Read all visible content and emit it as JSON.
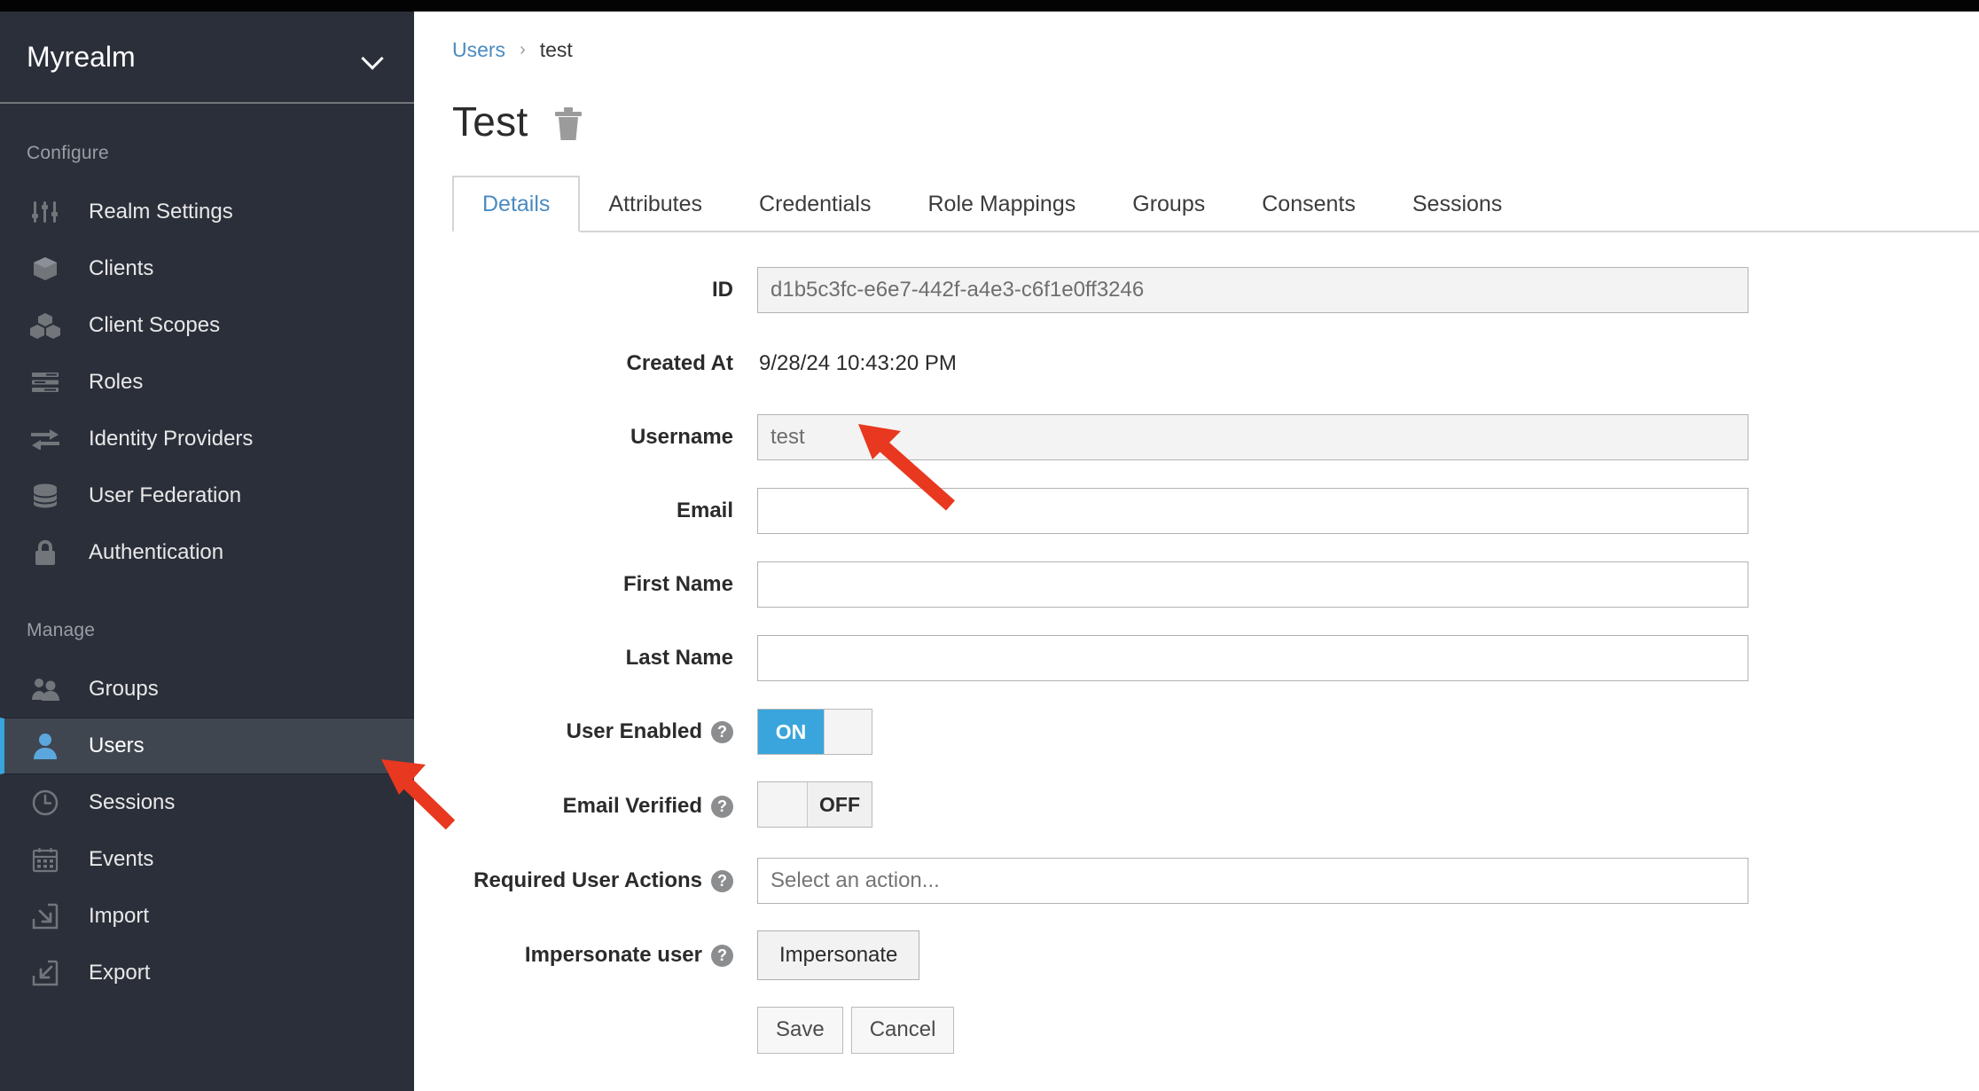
{
  "colors": {
    "sidebar_bg": "#2b2f3a",
    "sidebar_active_bg": "#3f4650",
    "accent_blue": "#39a5dc",
    "link_blue": "#4a8bc2",
    "annotation_red": "#e8381f"
  },
  "sidebar": {
    "realm": {
      "name": "Myrealm",
      "chevron_icon": "chevron-down-icon"
    },
    "sections": [
      {
        "label": "Configure",
        "items": [
          {
            "label": "Realm Settings",
            "icon": "sliders-icon",
            "active": false
          },
          {
            "label": "Clients",
            "icon": "cube-icon",
            "active": false
          },
          {
            "label": "Client Scopes",
            "icon": "cubes-icon",
            "active": false
          },
          {
            "label": "Roles",
            "icon": "list-bars-icon",
            "active": false
          },
          {
            "label": "Identity Providers",
            "icon": "exchange-arrows-icon",
            "active": false
          },
          {
            "label": "User Federation",
            "icon": "database-icon",
            "active": false
          },
          {
            "label": "Authentication",
            "icon": "lock-icon",
            "active": false
          }
        ]
      },
      {
        "label": "Manage",
        "items": [
          {
            "label": "Groups",
            "icon": "users-group-icon",
            "active": false
          },
          {
            "label": "Users",
            "icon": "user-icon",
            "active": true
          },
          {
            "label": "Sessions",
            "icon": "clock-icon",
            "active": false
          },
          {
            "label": "Events",
            "icon": "calendar-icon",
            "active": false
          },
          {
            "label": "Import",
            "icon": "import-arrow-icon",
            "active": false
          },
          {
            "label": "Export",
            "icon": "export-arrow-icon",
            "active": false
          }
        ]
      }
    ]
  },
  "breadcrumb": {
    "parent": "Users",
    "separator": "›",
    "current": "test"
  },
  "page": {
    "title": "Test",
    "delete_icon": "trash-icon"
  },
  "tabs": [
    {
      "label": "Details",
      "active": true
    },
    {
      "label": "Attributes",
      "active": false
    },
    {
      "label": "Credentials",
      "active": false
    },
    {
      "label": "Role Mappings",
      "active": false
    },
    {
      "label": "Groups",
      "active": false
    },
    {
      "label": "Consents",
      "active": false
    },
    {
      "label": "Sessions",
      "active": false
    }
  ],
  "form": {
    "id": {
      "label": "ID",
      "value": "d1b5c3fc-e6e7-442f-a4e3-c6f1e0ff3246"
    },
    "created_at": {
      "label": "Created At",
      "value": "9/28/24 10:43:20 PM"
    },
    "username": {
      "label": "Username",
      "value": "test"
    },
    "email": {
      "label": "Email",
      "value": ""
    },
    "first_name": {
      "label": "First Name",
      "value": ""
    },
    "last_name": {
      "label": "Last Name",
      "value": ""
    },
    "user_enabled": {
      "label": "User Enabled",
      "state": "ON",
      "on_text": "ON",
      "help": "?"
    },
    "email_verified": {
      "label": "Email Verified",
      "state": "OFF",
      "off_text": "OFF",
      "help": "?"
    },
    "required_user_actions": {
      "label": "Required User Actions",
      "placeholder": "Select an action...",
      "value": "",
      "help": "?"
    },
    "impersonate": {
      "label": "Impersonate user",
      "button_label": "Impersonate",
      "help": "?"
    },
    "actions": {
      "save_label": "Save",
      "cancel_label": "Cancel"
    }
  },
  "annotations": [
    {
      "name": "arrow-to-username-field",
      "color": "#e8381f"
    },
    {
      "name": "arrow-to-users-nav-item",
      "color": "#e8381f"
    }
  ]
}
